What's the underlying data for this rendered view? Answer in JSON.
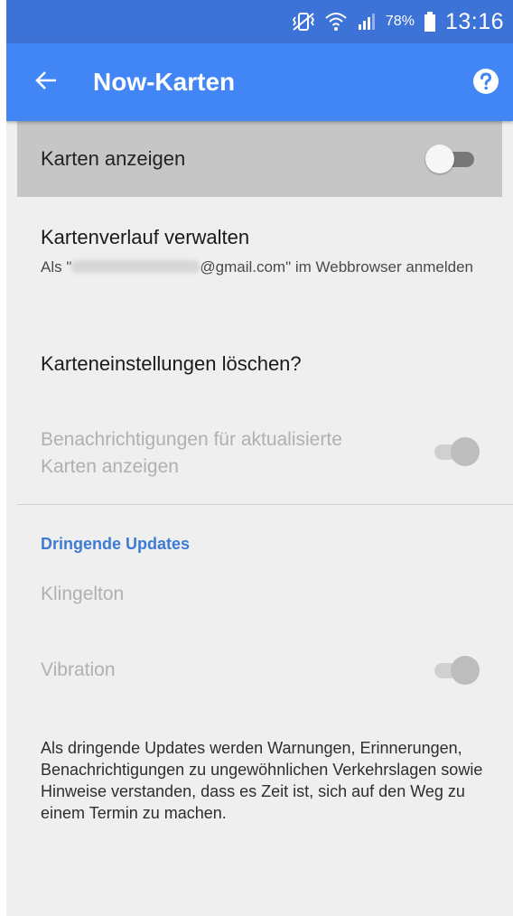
{
  "status_bar": {
    "battery_percent": "78%",
    "time": "13:16",
    "icons": [
      "mute-vibrate-icon",
      "wifi-icon",
      "signal-icon",
      "battery-icon"
    ]
  },
  "app_bar": {
    "title": "Now-Karten",
    "back_icon": "arrow-back-icon",
    "help_icon": "help-icon"
  },
  "settings": {
    "show_cards": {
      "label": "Karten anzeigen",
      "enabled": false
    },
    "history": {
      "title": "Kartenverlauf verwalten",
      "subtitle_prefix": "Als \"",
      "subtitle_suffix": "@gmail.com\" im Webbrowser anmelden"
    },
    "reset": {
      "title": "Karteneinstellungen löschen?"
    },
    "notifications": {
      "label": "Benachrichtigungen für aktualisierte Karten anzeigen",
      "enabled": true,
      "disabled": true
    }
  },
  "urgent_updates": {
    "header": "Dringende Updates",
    "ringtone_label": "Klingelton",
    "vibration_label": "Vibration",
    "vibration_enabled": true,
    "description": "Als dringende Updates werden Warnungen, Erinnerungen, Benachrichtigungen zu ungewöhnlichen Verkehrslagen sowie Hinweise verstanden, dass es Zeit ist, sich auf den Weg zu einem Termin zu machen."
  },
  "colors": {
    "status_bar": "#3d72d6",
    "app_bar": "#4285f4",
    "accent": "#3e7bd6",
    "background": "#efefef",
    "selected_row": "#c6c6c6"
  }
}
